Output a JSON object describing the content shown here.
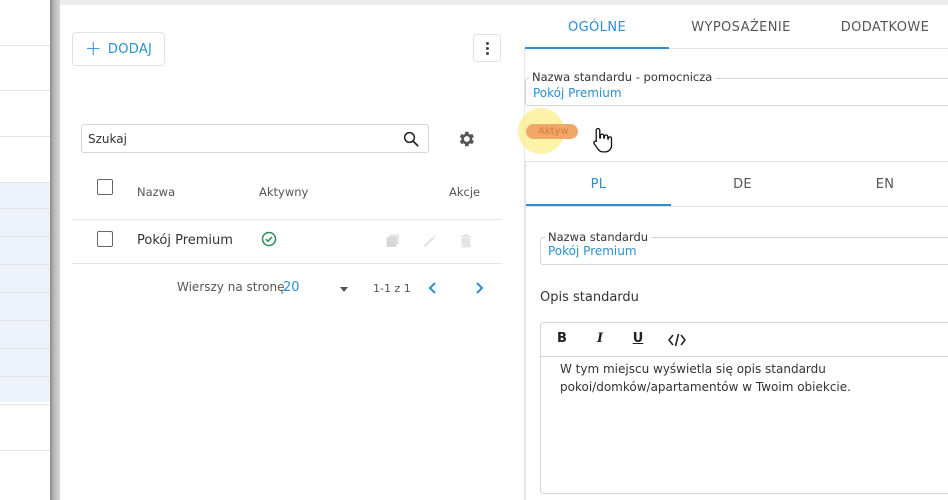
{
  "list": {
    "add_label": "DODAJ",
    "search_placeholder": "Szukaj",
    "columns": {
      "name": "Nazwa",
      "active": "Aktywny",
      "actions": "Akcje"
    },
    "rows": [
      {
        "name": "Pokój Premium",
        "active": true
      }
    ],
    "pagination": {
      "rows_label": "Wierszy na stronę",
      "rows_value": "20",
      "range": "1-1 z 1"
    }
  },
  "detail": {
    "tabs": [
      {
        "label": "OGÓLNE"
      },
      {
        "label": "WYPOSAŻENIE"
      },
      {
        "label": "DODATKOWE"
      }
    ],
    "helper_name": {
      "label": "Nazwa standardu - pomocnicza",
      "value": "Pokój Premium"
    },
    "toggle_label": "Aktyw",
    "lang_tabs": [
      {
        "label": "PL"
      },
      {
        "label": "DE"
      },
      {
        "label": "EN"
      }
    ],
    "std_name": {
      "label": "Nazwa standardu",
      "value": "Pokój Premium"
    },
    "description": {
      "title": "Opis standardu",
      "text": "W tym miejscu wyświetla się opis standardu pokoi/domków/apartamentów w Twoim obiekcie."
    }
  },
  "colors": {
    "accent": "#2b8fd0",
    "success": "#2e8b57",
    "toggle": "#f0a868"
  }
}
